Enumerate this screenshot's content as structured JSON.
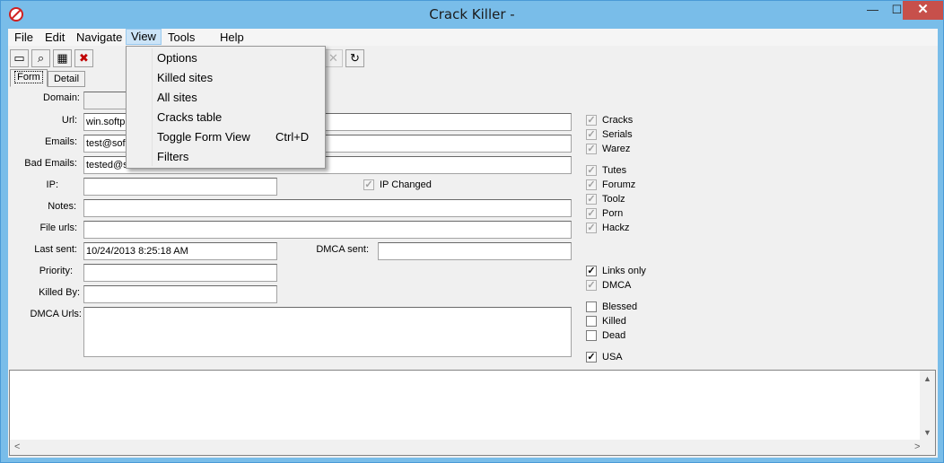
{
  "window": {
    "title": "Crack Killer -",
    "min": "—",
    "max": "☐",
    "close": "✕"
  },
  "menubar": {
    "items": [
      {
        "label": "File"
      },
      {
        "label": "Edit"
      },
      {
        "label": "Navigate"
      },
      {
        "label": "View"
      },
      {
        "label": "Tools"
      },
      {
        "label": "Help"
      }
    ]
  },
  "view_menu": {
    "items": [
      {
        "label": "Options",
        "shortcut": ""
      },
      {
        "label": "Killed sites",
        "shortcut": ""
      },
      {
        "label": "All sites",
        "shortcut": ""
      },
      {
        "label": "Cracks table",
        "shortcut": ""
      },
      {
        "label": "Toggle Form View",
        "shortcut": "Ctrl+D"
      },
      {
        "label": "Filters",
        "shortcut": ""
      }
    ]
  },
  "toolbar": {
    "icons": [
      "new-site-icon",
      "find-icon",
      "table-icon",
      "kill-icon",
      "stop-icon",
      "refresh-icon"
    ],
    "glyphs": [
      "▭",
      "⌕",
      "▦",
      "✖",
      "✕",
      "↻"
    ]
  },
  "tabs": [
    {
      "label": "Form"
    },
    {
      "label": "Detail"
    }
  ],
  "form": {
    "domain_label": "Domain:",
    "domain_value": "",
    "url_label": "Url:",
    "url_value": "win.softp",
    "emails_label": "Emails:",
    "emails_value": "test@sof",
    "bad_emails_label": "Bad Emails:",
    "bad_emails_value": "tested@s",
    "ip_label": "IP:",
    "ip_value": "",
    "ip_changed_label": "IP Changed",
    "ip_changed_checked": "✓",
    "notes_label": "Notes:",
    "notes_value": "",
    "file_urls_label": "File urls:",
    "file_urls_value": "",
    "last_sent_label": "Last sent:",
    "last_sent_value": "10/24/2013 8:25:18 AM",
    "dmca_sent_label": "DMCA sent:",
    "dmca_sent_value": "",
    "priority_label": "Priority:",
    "priority_value": "",
    "killed_by_label": "Killed By:",
    "killed_by_value": "",
    "dmca_urls_label": "DMCA Urls:",
    "dmca_urls_value": ""
  },
  "checks": {
    "cracks": {
      "label": "Cracks",
      "mark": "✓"
    },
    "serials": {
      "label": "Serials",
      "mark": "✓"
    },
    "warez": {
      "label": "Warez",
      "mark": "✓"
    },
    "tutes": {
      "label": "Tutes",
      "mark": "✓"
    },
    "forumz": {
      "label": "Forumz",
      "mark": "✓"
    },
    "toolz": {
      "label": "Toolz",
      "mark": "✓"
    },
    "porn": {
      "label": "Porn",
      "mark": "✓"
    },
    "hackz": {
      "label": "Hackz",
      "mark": "✓"
    },
    "links_only": {
      "label": "Links only",
      "mark": "✓"
    },
    "dmca": {
      "label": "DMCA",
      "mark": "✓"
    },
    "blessed": {
      "label": "Blessed",
      "mark": ""
    },
    "killed": {
      "label": "Killed",
      "mark": ""
    },
    "dead": {
      "label": "Dead",
      "mark": ""
    },
    "usa": {
      "label": "USA",
      "mark": "✓"
    }
  },
  "log": {
    "text": ""
  },
  "scroll": {
    "up": "▲",
    "down": "▼",
    "left": "<",
    "right": ">"
  }
}
